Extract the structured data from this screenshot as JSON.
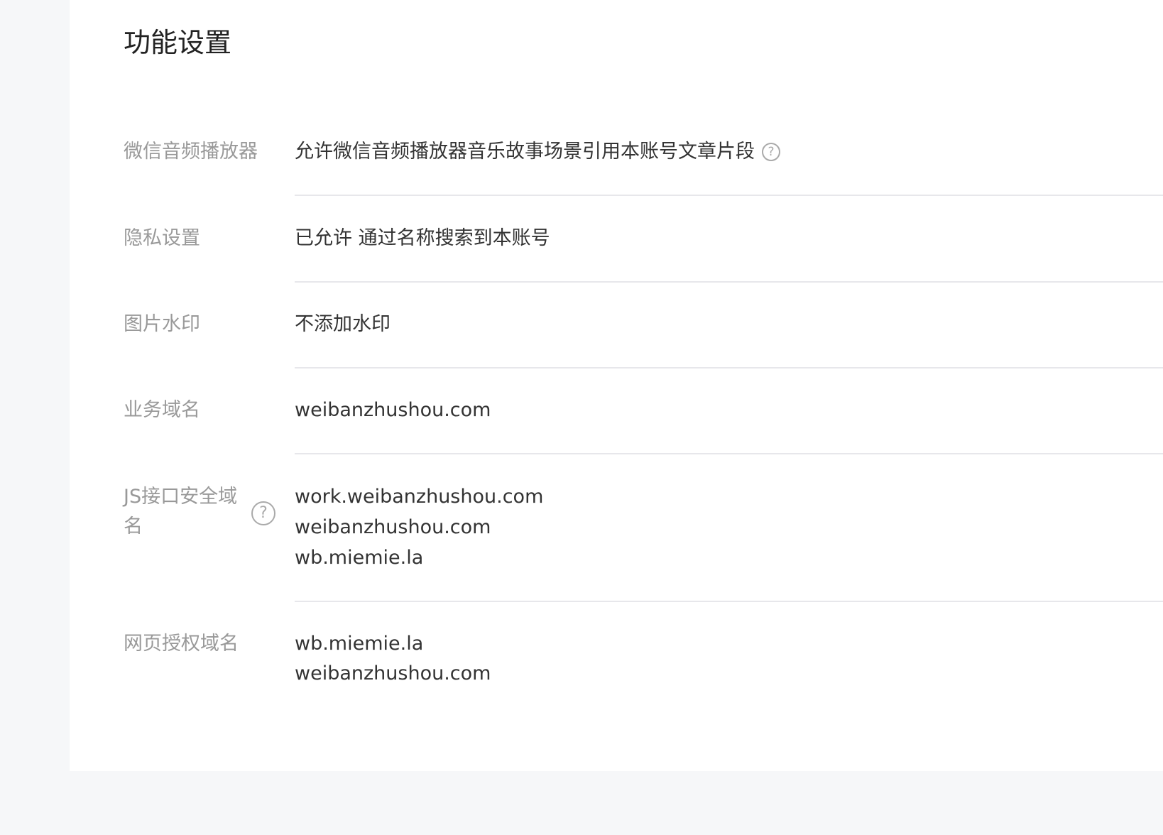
{
  "title": "功能设置",
  "rows": [
    {
      "label": "微信音频播放器",
      "value": "允许微信音频播放器音乐故事场景引用本账号文章片段",
      "help_icon": "question-circle-icon"
    },
    {
      "label": "隐私设置",
      "value": "已允许 通过名称搜索到本账号"
    },
    {
      "label": "图片水印",
      "value": "不添加水印"
    },
    {
      "label": "业务域名",
      "value": "weibanzhushou.com"
    },
    {
      "label": "JS接口安全域名",
      "help_icon": "question-circle-icon",
      "values": [
        "work.weibanzhushou.com",
        "weibanzhushou.com",
        "wb.miemie.la"
      ]
    },
    {
      "label": "网页授权域名",
      "values": [
        "wb.miemie.la",
        "weibanzhushou.com"
      ]
    }
  ],
  "help_glyph": "?",
  "colors": {
    "background": "#f6f7f9",
    "card": "#ffffff",
    "label": "#999999",
    "value": "#333333",
    "title": "#222222",
    "divider": "#e7e7eb"
  }
}
